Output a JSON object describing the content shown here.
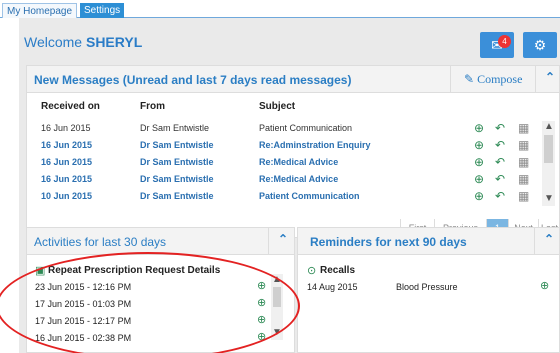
{
  "tabs": {
    "home": "My Homepage",
    "settings": "Settings"
  },
  "welcome": {
    "prefix": "Welcome",
    "user": "SHERYL"
  },
  "header_buttons": {
    "mail_icon": "envelope-icon",
    "mail_badge": "4",
    "settings_icon": "gear-icon"
  },
  "messages": {
    "title": "New Messages (Unread and last 7 days read messages)",
    "compose_label": "Compose",
    "columns": {
      "received": "Received on",
      "from": "From",
      "subject": "Subject"
    },
    "rows": [
      {
        "date": "16 Jun 2015",
        "from": "Dr Sam Entwistle",
        "subject": "Patient Communication",
        "unread": false
      },
      {
        "date": "16 Jun 2015",
        "from": "Dr Sam Entwistle",
        "subject": "Re:Adminstration Enquiry",
        "unread": true
      },
      {
        "date": "16 Jun 2015",
        "from": "Dr Sam Entwistle",
        "subject": "Re:Medical Advice",
        "unread": true
      },
      {
        "date": "16 Jun 2015",
        "from": "Dr Sam Entwistle",
        "subject": "Re:Medical Advice",
        "unread": true
      },
      {
        "date": "10 Jun 2015",
        "from": "Dr Sam Entwistle",
        "subject": "Patient Communication",
        "unread": true
      }
    ],
    "pager": {
      "first": "First",
      "previous": "Previous",
      "current": "1",
      "next": "Next",
      "last": "Last"
    }
  },
  "activities": {
    "title": "Activities for last 30 days",
    "section": "Repeat Prescription Request Details",
    "items": [
      "23 Jun 2015 - 12:16 PM",
      "17 Jun 2015 - 01:03 PM",
      "17 Jun 2015 - 12:17 PM",
      "16 Jun 2015 - 02:38 PM"
    ]
  },
  "reminders": {
    "title": "Reminders for next 90 days",
    "section": "Recalls",
    "items": [
      {
        "date": "14 Aug 2015",
        "desc": "Blood Pressure"
      }
    ]
  },
  "colors": {
    "accent": "#2b7ec4",
    "annotation": "#e32222"
  }
}
